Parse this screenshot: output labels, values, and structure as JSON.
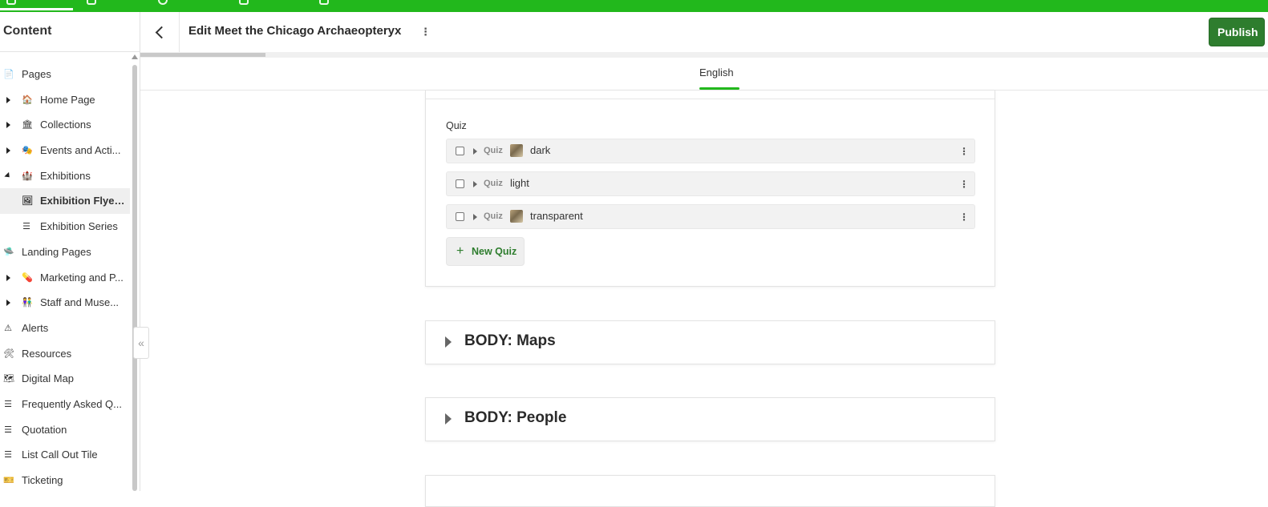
{
  "header": {
    "title": "Edit Meet the Chicago Archaeopteryx",
    "publish_label": "Publish"
  },
  "sidebar": {
    "title": "Content",
    "items": [
      {
        "label": "Pages",
        "icon": "page-icon"
      },
      {
        "label": "Home Page",
        "icon": "house-icon"
      },
      {
        "label": "Collections",
        "icon": "museum-icon"
      },
      {
        "label": "Events and Acti...",
        "icon": "masks-icon"
      },
      {
        "label": "Exhibitions",
        "icon": "gallery-icon"
      },
      {
        "label": "Exhibition Flyer ...",
        "icon": "framed-picture-icon"
      },
      {
        "label": "Exhibition Series",
        "icon": "list-icon"
      },
      {
        "label": "Landing Pages",
        "icon": "ufo-icon"
      },
      {
        "label": "Marketing and P...",
        "icon": "pill-icon"
      },
      {
        "label": "Staff and Muse...",
        "icon": "people-icon"
      },
      {
        "label": "Alerts",
        "icon": "warning-icon"
      },
      {
        "label": "Resources",
        "icon": "tools-icon"
      },
      {
        "label": "Digital Map",
        "icon": "world-map-icon"
      },
      {
        "label": "Frequently Asked Q...",
        "icon": "list-icon"
      },
      {
        "label": "Quotation",
        "icon": "list-icon"
      },
      {
        "label": "List Call Out Tile",
        "icon": "list-icon"
      },
      {
        "label": "Ticketing",
        "icon": "ticket-icon"
      }
    ]
  },
  "language_tab": "English",
  "quiz_section": {
    "label": "Quiz",
    "items": [
      {
        "type": "Quiz",
        "name": "dark",
        "has_thumbnail": true
      },
      {
        "type": "Quiz",
        "name": "light",
        "has_thumbnail": false
      },
      {
        "type": "Quiz",
        "name": "transparent",
        "has_thumbnail": true
      }
    ],
    "new_button_label": "New Quiz"
  },
  "sections": [
    {
      "title": "BODY: Maps"
    },
    {
      "title": "BODY: People"
    }
  ],
  "colors": {
    "topbar": "#22b81c",
    "publish_button": "#2e7d2e",
    "accent": "#22b81c"
  }
}
